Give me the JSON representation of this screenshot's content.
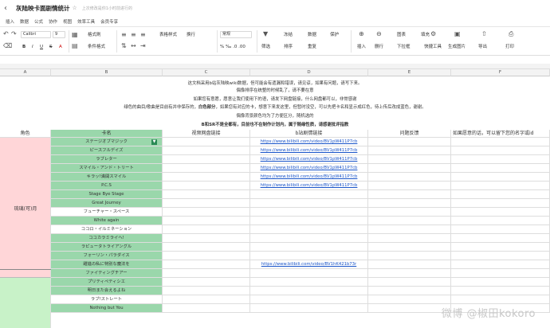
{
  "window": {
    "title": "灰陆映卡面剧情统计",
    "sync_status": "上次修改是你1小时前进行的"
  },
  "menu": [
    "插入",
    "数据",
    "公式",
    "协作",
    "视图",
    "效率工具",
    "会员专享"
  ],
  "toolbar": {
    "font_name": "Calibri",
    "font_size": "9",
    "format_painter": "格式刷",
    "cell_style": "表格样式",
    "cond_format": "条件格式",
    "wrap": "换行",
    "number_format": "常规",
    "filter": "筛选",
    "sort_asc": "排序",
    "sort_desc": "排序",
    "dedupe": "重复",
    "freeze": "冻结",
    "data": "数据",
    "protect": "保护",
    "insert": "插入",
    "delete": "删行",
    "dropdown": "下拉框",
    "chart": "图表",
    "fill": "填充",
    "quick_tools": "快捷工具",
    "smart_table": "生成图片",
    "export": "导出",
    "print": "打印"
  },
  "columns": [
    "A",
    "B",
    "C",
    "D",
    "E",
    "F"
  ],
  "notes": [
    {
      "text": "这文档采用b站灰陆映wiki数据，但可能会有遗漏和错误，请见谅，如果有问题，请写下来。"
    },
    {
      "text": "偶像排序在统整的时候乱了，请不要在意"
    },
    {
      "text": "如果您有意愿，愿意让我们使用下的语，请发下网盘链接，什么网盘都可以，非常感谢"
    },
    {
      "pre": "绿色的曲目/歌曲是目前有并非保存的，",
      "bold": "白色部分",
      "post": "，如果您有对应的卡，想意下来发这里，但暂时没空，可以先把卡名和显示成红色，待上传后改成蓝色，谢谢。"
    },
    {
      "text": "偶像背景颜色均为了方便区分，随机选的"
    },
    {
      "text": "B和SR不是全都有，目前也不在制作计划内，属于随缘性质，请感谢批评指教",
      "bold_all": true
    }
  ],
  "headers": {
    "a": "角色",
    "b": "卡名",
    "c": "视频网盘链接",
    "d": "b站剧情链接",
    "e": "问题反馈",
    "f": "如果愿意的话，可以留下您的名字或id"
  },
  "groups": [
    {
      "label": "琉璃(可)月"
    }
  ],
  "rows": [
    {
      "card": "ステージオブマジック",
      "link": "https://www.bilibili.com/video/BV1pW411P7cb",
      "style": "green"
    },
    {
      "card": "ピースフルデイズ",
      "link": "https://www.bilibili.com/video/BV1pW411P7cb",
      "style": "green"
    },
    {
      "card": "ラブレター",
      "link": "https://www.bilibili.com/video/BV1pW411P7cb",
      "style": "green"
    },
    {
      "card": "スマイル・アンド・トリート",
      "link": "https://www.bilibili.com/video/BV1pW411P7cb",
      "style": "green"
    },
    {
      "card": "キラッ!満開スマイル",
      "link": "https://www.bilibili.com/video/BV1pW411P7cb",
      "style": "green"
    },
    {
      "card": "P.C.S",
      "link": "https://www.bilibili.com/video/BV1pW411P7cb",
      "style": "green"
    },
    {
      "card": "Stage Bye Stage",
      "link": "",
      "style": "green"
    },
    {
      "card": "Great Journey",
      "link": "",
      "style": "green"
    },
    {
      "card": "フューチャー・スペース",
      "link": "",
      "style": "white"
    },
    {
      "card": "White again",
      "link": "",
      "style": "green"
    },
    {
      "card": "ココロ・イルミネーション",
      "link": "",
      "style": "white"
    },
    {
      "card": "ココカラミライへ!",
      "link": "",
      "style": "green"
    },
    {
      "card": "ラピュータトライアングル",
      "link": "",
      "style": "green"
    },
    {
      "card": "フォーリン・パラダイス",
      "link": "",
      "style": "green"
    },
    {
      "card": "躍進の私に特別な魔法を",
      "link": "https://www.bilibili.com/video/BV1hK421b73r",
      "style": "green"
    },
    {
      "card": "ファイティングチアー",
      "link": "",
      "style": "green"
    },
    {
      "card": "プリティペティシエ",
      "link": "",
      "style": "green"
    },
    {
      "card": "明日また会えるよね",
      "link": "",
      "style": "green"
    },
    {
      "card": "ラブ!ストレート",
      "link": "",
      "style": "white"
    },
    {
      "card": "Nothing but You",
      "link": "",
      "style": "green"
    }
  ],
  "watermark": "微博 @椒田kokoro"
}
